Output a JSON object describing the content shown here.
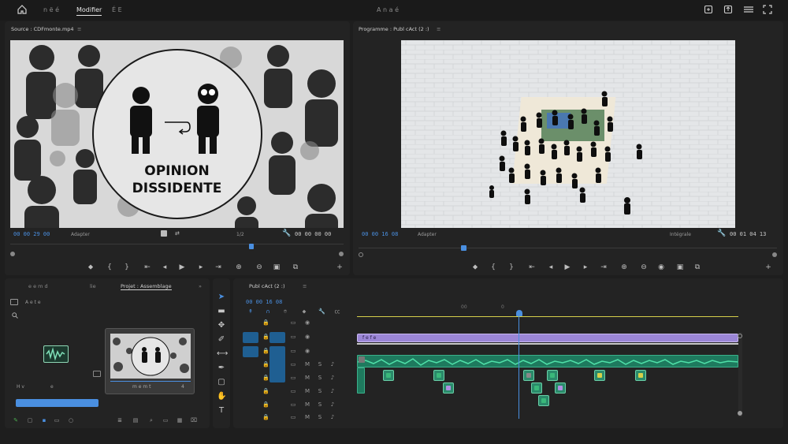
{
  "topbar": {
    "workspaces": [
      "n ë é",
      "Modifier",
      "É E"
    ],
    "active_workspace_index": 1,
    "center_title": "A  n a é"
  },
  "source_monitor": {
    "tab_label": "Source : CDFmonte.mp4",
    "tab_menu": "≡",
    "graphic": {
      "line1": "OPINION",
      "line2": "DISSIDENTE"
    },
    "timecode": "00 00 29 00",
    "fit_label": "Adapter",
    "resolution": "1/2",
    "duration": "00 00 00 00"
  },
  "program_monitor": {
    "tab_label": "Programme : Publ cAct (2 :)",
    "tab_menu": "≡",
    "timecode": "00 00 16 08",
    "fit_label": "Adapter",
    "quality": "Intégrale",
    "duration": "00 01 04 13"
  },
  "project_panel": {
    "tabs": [
      "e  e m d",
      "lie",
      "Projet : Assemblage"
    ],
    "active_tab_index": 2,
    "tab_more": "»",
    "subtitle": "A  e  t e",
    "clip_label": "m  e  m t",
    "clip_duration": "4",
    "bottom_label_left": "H  v",
    "bottom_label_right": "e"
  },
  "timeline": {
    "tab_label": "Publ cAct (2 :)",
    "tab_menu": "≡",
    "timecode": "00 00 16 08",
    "ruler_labels": [
      "00",
      "0"
    ],
    "video_clip_label": "f  e  f  e"
  },
  "colors": {
    "accent": "#4a8fe0",
    "video_clip": "#9b86d6",
    "audio_clip": "#1e7a5e",
    "playhead": "#4a8fe0",
    "work_area": "#d6d04a"
  },
  "icons": [
    "home-icon",
    "bell-icon",
    "share-icon",
    "settings-icon",
    "wrench-icon",
    "marker-icon",
    "play-icon",
    "step-back-icon",
    "step-forward-icon",
    "insert-icon",
    "overwrite-icon",
    "camera-icon",
    "export-icon",
    "add-icon",
    "selection-tool-icon",
    "track-select-icon",
    "ripple-icon",
    "razor-icon",
    "slip-icon",
    "pen-icon",
    "rect-icon",
    "hand-icon",
    "type-icon",
    "search-icon"
  ]
}
